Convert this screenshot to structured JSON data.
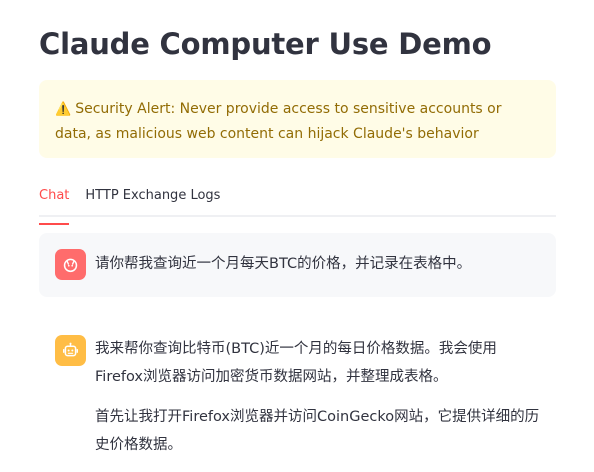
{
  "page": {
    "title": "Claude Computer Use Demo"
  },
  "alert": {
    "icon": "warning-icon",
    "text": "Security Alert: Never provide access to sensitive accounts or data, as malicious web content can hijack Claude's behavior"
  },
  "tabs": [
    {
      "label": "Chat",
      "active": true
    },
    {
      "label": "HTTP Exchange Logs",
      "active": false
    }
  ],
  "messages": {
    "user": {
      "avatar_icon": "user-face-icon",
      "text": "请你帮我查询近一个月每天BTC的价格，并记录在表格中。"
    },
    "assistant": {
      "avatar_icon": "robot-icon",
      "paragraphs": [
        "我来帮你查询比特币(BTC)近一个月的每日价格数据。我会使用Firefox浏览器访问加密货币数据网站，并整理成表格。",
        "首先让我打开Firefox浏览器并访问CoinGecko网站，它提供详细的历史价格数据。"
      ]
    }
  },
  "colors": {
    "accent": "#ff4b4b",
    "alert_bg": "#fffce7",
    "alert_text": "#926c05",
    "user_avatar": "#ff6c6c",
    "bot_avatar": "#ffbd45"
  }
}
